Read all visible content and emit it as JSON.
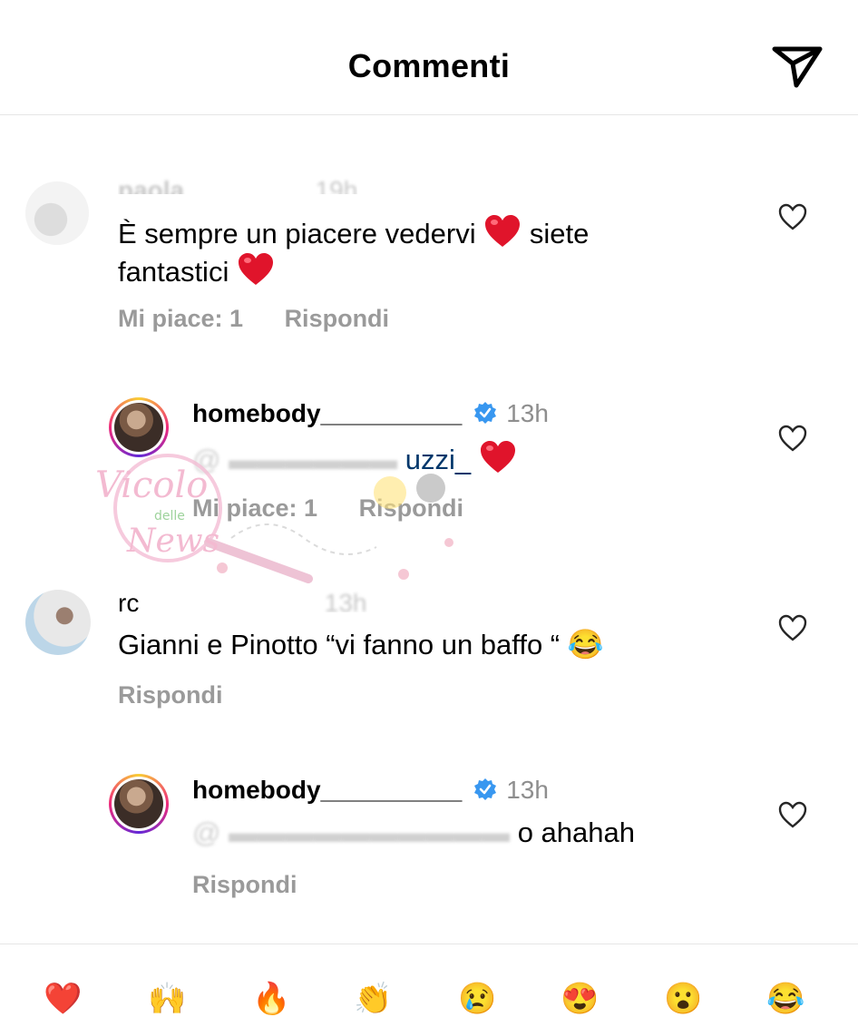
{
  "header": {
    "title": "Commenti"
  },
  "comments": [
    {
      "username": "paola",
      "time": "19h",
      "text": "È sempre un piacere vedervi",
      "text_after": "siete",
      "text_line2": "fantastici",
      "likes_label": "Mi piace: 1",
      "reply_label": "Rispondi"
    },
    {
      "username": "homebody__________",
      "time": "13h",
      "mention": "@uzzi_",
      "mention_visible": "uzzi_",
      "likes_label": "Mi piace: 1",
      "reply_label": "Rispondi"
    },
    {
      "username": "rc",
      "time": "13h",
      "text": "Gianni e Pinotto “vi fanno un baffo “",
      "emoji": "😂",
      "reply_label": "Rispondi"
    },
    {
      "username": "homebody__________",
      "time": "13h",
      "text_visible": "o ahahah",
      "reply_label": "Rispondi"
    }
  ],
  "watermark": {
    "line1": "Vicolo",
    "line2": "delle",
    "line3": "News"
  },
  "reactions": [
    "❤️",
    "🙌",
    "🔥",
    "👏",
    "😢",
    "😍",
    "😮",
    "😂"
  ],
  "colors": {
    "verified": "#3897f0",
    "heart": "#e0142b",
    "meta": "#9a9a9a"
  }
}
